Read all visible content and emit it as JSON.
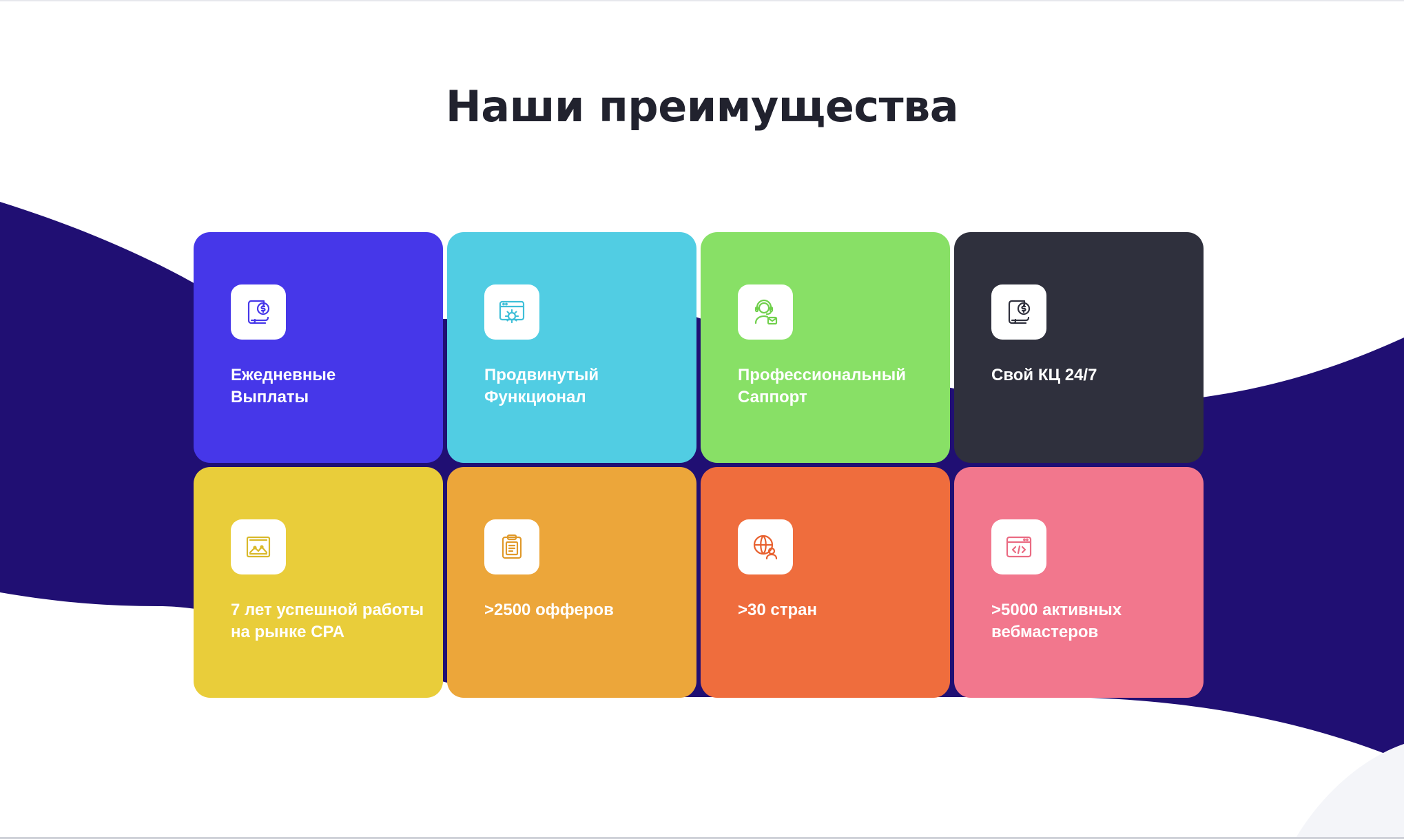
{
  "section": {
    "title": "Наши преимущества"
  },
  "colors": {
    "wave": "#200f73",
    "title_text": "#21222e",
    "card_text": "#ffffff",
    "icon_tile": "#ffffff"
  },
  "cards": [
    {
      "label": "Ежедневные\nВыплаты",
      "icon": "payout-document-icon",
      "bg": "#4637e9",
      "accent": "#4637e9"
    },
    {
      "label": "Продвинутый\nФункционал",
      "icon": "browser-gear-icon",
      "bg": "#51cde3",
      "accent": "#3fbfd8"
    },
    {
      "label": "Профессиональный\nСаппорт",
      "icon": "support-agent-icon",
      "bg": "#88e066",
      "accent": "#70d04c"
    },
    {
      "label": "Свой КЦ 24/7",
      "icon": "call-center-document-icon",
      "bg": "#2f303d",
      "accent": "#2f303d"
    },
    {
      "label": "7 лет успешной работы\nна рынке CPA",
      "icon": "chart-image-icon",
      "bg": "#e9cd3a",
      "accent": "#d9b92a"
    },
    {
      "label": ">2500 офферов",
      "icon": "clipboard-icon",
      "bg": "#eca63a",
      "accent": "#e0992a"
    },
    {
      "label": ">30 стран",
      "icon": "globe-user-icon",
      "bg": "#ef6d3d",
      "accent": "#e8602e"
    },
    {
      "label": ">5000 активных\nвебмастеров",
      "icon": "code-window-icon",
      "bg": "#f2778d",
      "accent": "#ea6a82"
    }
  ]
}
